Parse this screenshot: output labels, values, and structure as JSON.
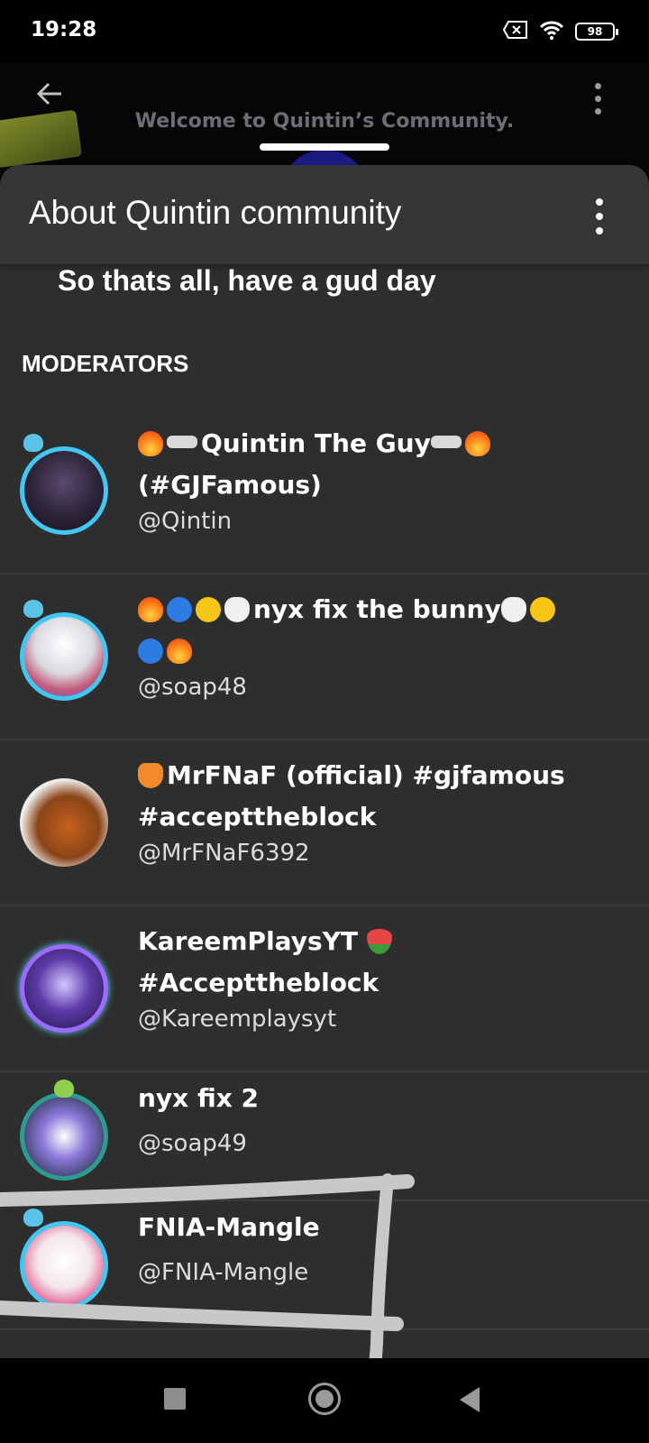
{
  "status_bar": {
    "time": "19:28",
    "battery_level": "98",
    "icons": [
      "no-sim-icon",
      "wifi-icon",
      "battery-icon"
    ]
  },
  "background_page": {
    "welcome_text": "Welcome to Quintin’s Community.",
    "icons": [
      "back-arrow-icon",
      "more-vert-icon"
    ]
  },
  "sheet": {
    "title": "About Quintin community",
    "about_text": "So thats all, have a gud day",
    "menu_icon": "more-vert-icon"
  },
  "moderators": {
    "section_title": "MODERATORS",
    "items": [
      {
        "name": "Quintin The Guy",
        "name_line2": "(#GJFamous)",
        "handle": "@Qintin",
        "emojis_prefix": [
          "fire",
          "glasses"
        ],
        "emojis_suffix": [
          "glasses",
          "fire"
        ]
      },
      {
        "name": "nyx fix the bunny",
        "name_line2": "",
        "handle": "@soap48",
        "emojis_prefix": [
          "fire",
          "blue-circle",
          "yellow-circle",
          "bunny"
        ],
        "emojis_suffix": [
          "bunny",
          "yellow-circle",
          "blue-circle",
          "fire"
        ]
      },
      {
        "name": "MrFNaF (official) #gjfamous",
        "name_line2": "#accepttheblock",
        "handle": "@MrFNaF6392",
        "emojis_prefix": [
          "fox"
        ],
        "emojis_suffix": []
      },
      {
        "name": "KareemPlaysYT",
        "name_line2": "#Accepttheblock",
        "handle": "@Kareemplaysyt",
        "emojis_prefix": [],
        "emojis_suffix": [
          "watermelon"
        ]
      },
      {
        "name": "nyx fix 2",
        "name_line2": "",
        "handle": "@soap49",
        "emojis_prefix": [],
        "emojis_suffix": []
      },
      {
        "name": "FNIA-Mangle",
        "name_line2": "",
        "handle": "@FNIA-Mangle",
        "emojis_prefix": [],
        "emojis_suffix": []
      }
    ]
  },
  "nav_bar": {
    "icons": [
      "recents-square-icon",
      "home-circle-icon",
      "back-triangle-icon"
    ]
  },
  "colors": {
    "sheet_bg": "#2e2e2e",
    "header_bg": "#363636",
    "avatar_ring": "#43c6f0",
    "scribble": "#c8c8c8"
  }
}
